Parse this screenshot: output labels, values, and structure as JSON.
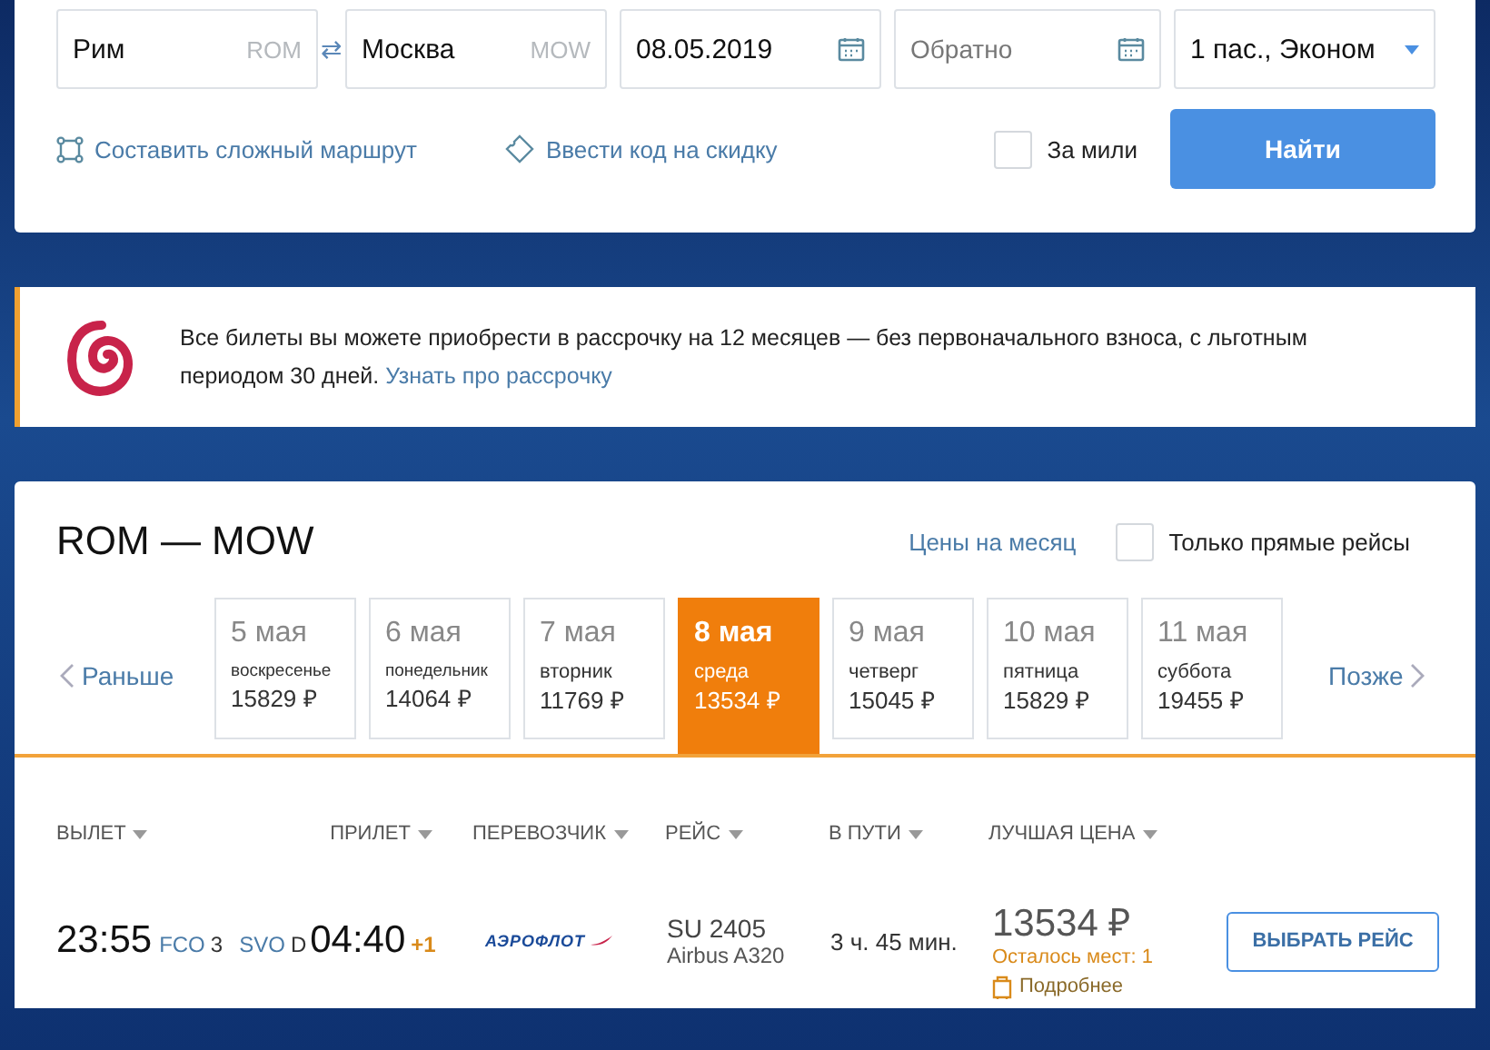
{
  "search": {
    "origin": {
      "value": "Рим",
      "code": "ROM"
    },
    "swap": "⇄",
    "destination": {
      "value": "Москва",
      "code": "MOW"
    },
    "depart": {
      "value": "08.05.2019"
    },
    "return": {
      "placeholder": "Обратно"
    },
    "passengers": {
      "value": "1 пас., Эконом"
    },
    "complex_route": "Составить сложный маршрут",
    "promo_code": "Ввести код на скидку",
    "miles": {
      "label": "За мили",
      "checked": false
    },
    "submit": "Найти"
  },
  "banner": {
    "text": "Все билеты вы можете приобрести в рассрочку на 12 месяцев — без первоначального взноса, с льготным периодом 30 дней.",
    "link": "Узнать про рассрочку"
  },
  "results": {
    "title": "ROM — MOW",
    "month_prices": "Цены на месяц",
    "direct_only": {
      "label": "Только прямые рейсы",
      "checked": false
    },
    "earlier": "Раньше",
    "later": "Позже",
    "days": [
      {
        "date": "5 мая",
        "weekday": "воскресенье",
        "price": "15829 ₽",
        "selected": false
      },
      {
        "date": "6 мая",
        "weekday": "понедельник",
        "price": "14064 ₽",
        "selected": false
      },
      {
        "date": "7 мая",
        "weekday": "вторник",
        "price": "11769 ₽",
        "selected": false
      },
      {
        "date": "8 мая",
        "weekday": "среда",
        "price": "13534 ₽",
        "selected": true
      },
      {
        "date": "9 мая",
        "weekday": "четверг",
        "price": "15045 ₽",
        "selected": false
      },
      {
        "date": "10 мая",
        "weekday": "пятница",
        "price": "15829 ₽",
        "selected": false
      },
      {
        "date": "11 мая",
        "weekday": "суббота",
        "price": "19455 ₽",
        "selected": false
      }
    ],
    "columns": [
      "ВЫЛЕТ",
      "ПРИЛЕТ",
      "ПЕРЕВОЗЧИК",
      "РЕЙС",
      "В ПУТИ",
      "ЛУЧШАЯ ЦЕНА"
    ],
    "flights": [
      {
        "depart_time": "23:55",
        "depart_airport": "FCO",
        "depart_terminal": "3",
        "arrive_airport": "SVO",
        "arrive_terminal": "D",
        "arrive_time": "04:40",
        "day_shift": "+1",
        "carrier": "АЭРОФЛОТ",
        "flight_number": "SU 2405",
        "aircraft": "Airbus A320",
        "duration": "3 ч. 45 мин.",
        "price": "13534 ₽",
        "seats_left": "Осталось мест: 1",
        "details": "Подробнее",
        "select": "ВЫБРАТЬ РЕЙС"
      }
    ]
  }
}
